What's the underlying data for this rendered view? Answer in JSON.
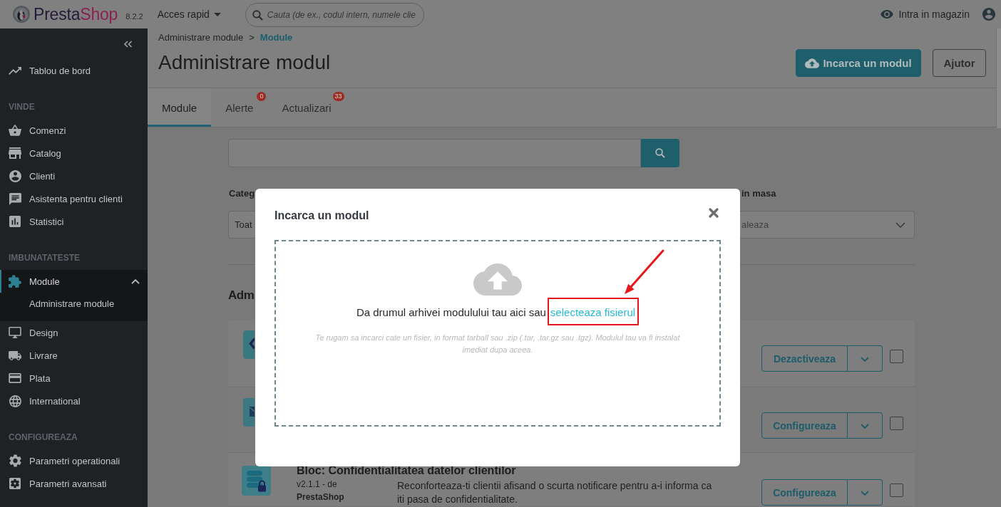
{
  "topbar": {
    "brand": [
      "Presta",
      "Shop"
    ],
    "version": "8.2.2",
    "quick_access": "Acces rapid",
    "search": {
      "placeholder": "Cauta (de ex., codul intern, numele clie"
    },
    "shop_link": "Intra in magazin"
  },
  "sidebar": {
    "top_items": [
      {
        "label": "Tablou de bord",
        "selected": false,
        "expanded": false
      }
    ],
    "sections": [
      {
        "title": "VINDE",
        "items": [
          {
            "label": "Comenzi",
            "selected": false,
            "expanded": false
          },
          {
            "label": "Catalog",
            "selected": false,
            "expanded": false
          },
          {
            "label": "Clienti",
            "selected": false,
            "expanded": false
          },
          {
            "label": "Asistenta pentru clienti",
            "selected": false,
            "expanded": false
          },
          {
            "label": "Statistici",
            "selected": false,
            "expanded": false
          }
        ]
      },
      {
        "title": "IMBUNATATESTE",
        "items": [
          {
            "label": "Module",
            "selected": true,
            "expanded": true,
            "children": [
              {
                "label": "Administrare module",
                "selected": false
              }
            ]
          },
          {
            "label": "Design",
            "selected": false,
            "expanded": false
          },
          {
            "label": "Livrare",
            "selected": false,
            "expanded": false
          },
          {
            "label": "Plata",
            "selected": false,
            "expanded": false
          },
          {
            "label": "International",
            "selected": false,
            "expanded": false
          }
        ]
      },
      {
        "title": "CONFIGUREAZA",
        "items": [
          {
            "label": "Parametri operationali",
            "selected": false,
            "expanded": false
          },
          {
            "label": "Parametri avansati",
            "selected": false,
            "expanded": false
          }
        ]
      }
    ]
  },
  "header": {
    "breadcrumbs": [
      {
        "label": "Administrare module",
        "selected": false
      },
      {
        "label": "Module",
        "selected": true
      }
    ],
    "breadcrumb_separator": ">",
    "title": "Administrare modul",
    "buttons": [
      {
        "label": "Incarca un modul",
        "kind": "primary"
      },
      {
        "label": "Ajutor",
        "kind": "outline"
      }
    ]
  },
  "tabs": [
    {
      "label": "Module",
      "selected": true
    },
    {
      "label": "Alerte",
      "selected": false,
      "badge": "0"
    },
    {
      "label": "Actualizari",
      "selected": false,
      "badge": "33"
    }
  ],
  "filters": [
    {
      "label": "Categ",
      "value": "Toat"
    },
    {
      "label": "in masa",
      "placeholder": "aleaza"
    }
  ],
  "section_title": "Adm",
  "modules": [
    {
      "action": "Dezactiveaza",
      "checked": false
    },
    {
      "action": "Configureaza",
      "checked": false
    },
    {
      "title": "Bloc: Confidentialitatea datelor clientilor",
      "meta": "v2.1.1 - de **PrestaShop**",
      "description": "Reconforteaza-ti clientii afisand o scurta notificare pentru a-i informa ca iti pasa de confidentialitate.",
      "action": "Configureaza",
      "checked": false
    }
  ],
  "modal": {
    "title": "Incarca un modul",
    "dropzone": {
      "text": "Da drumul arhivei modulului tau aici sau",
      "link": "selecteaza fisierul",
      "highlighted": true,
      "hint": "Te rugam sa incarci cate un fisier, in format tarball sau .zip (.tar, .tar.gz sau .tgz). Modulul tau va fi instalat imediat dupa aceea."
    }
  }
}
